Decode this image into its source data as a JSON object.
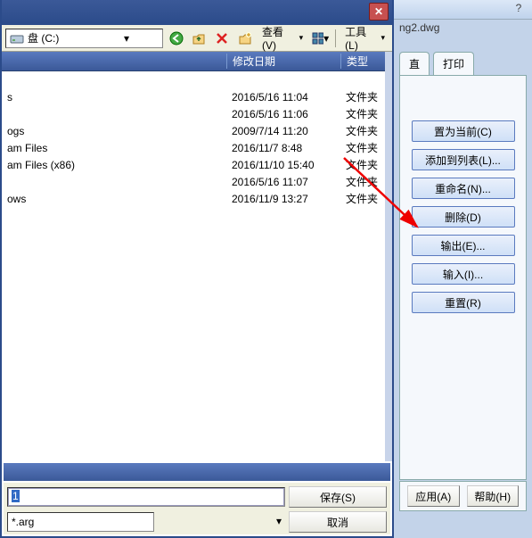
{
  "dialog": {
    "address_label": "盘 (C:)",
    "view_menu": "查看(V)",
    "tool_menu": "工具(L)",
    "headers": {
      "name": "",
      "date": "修改日期",
      "type": "类型"
    },
    "rows": [
      {
        "name": "",
        "date": "",
        "type": ""
      },
      {
        "name": "s",
        "date": "2016/5/16 11:04",
        "type": "文件夹"
      },
      {
        "name": "",
        "date": "2016/5/16 11:06",
        "type": "文件夹"
      },
      {
        "name": "ogs",
        "date": "2009/7/14 11:20",
        "type": "文件夹"
      },
      {
        "name": "am Files",
        "date": "2016/11/7 8:48",
        "type": "文件夹"
      },
      {
        "name": "am Files (x86)",
        "date": "2016/11/10 15:40",
        "type": "文件夹"
      },
      {
        "name": "",
        "date": "2016/5/16 11:07",
        "type": "文件夹"
      },
      {
        "name": "ows",
        "date": "2016/11/9 13:27",
        "type": "文件夹"
      }
    ],
    "filename_value": "1",
    "filetype_value": "*.arg",
    "save_btn": "保存(S)",
    "cancel_btn": "取消"
  },
  "bgapp": {
    "title_fragment": "ng2.dwg",
    "help": "?",
    "tab_partial": "直",
    "tab_print": "打印",
    "buttons": [
      "置为当前(C)",
      "添加到列表(L)...",
      "重命名(N)...",
      "删除(D)",
      "输出(E)...",
      "输入(I)...",
      "重置(R)"
    ],
    "apply_btn": "应用(A)",
    "help_btn": "帮助(H)"
  }
}
